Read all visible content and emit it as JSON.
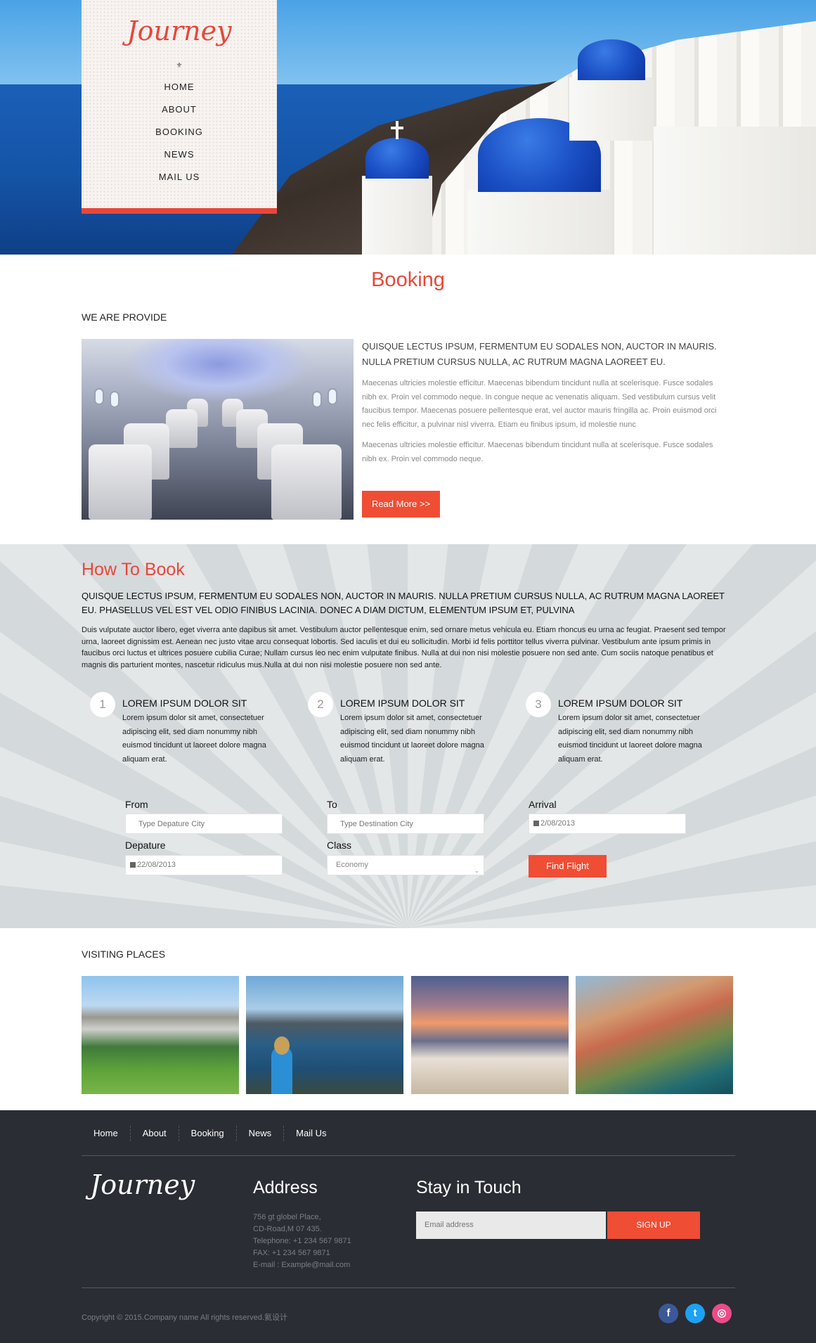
{
  "brand": {
    "logo": "Journey",
    "ornament": "⚜"
  },
  "nav": [
    "HOME",
    "ABOUT",
    "BOOKING",
    "NEWS",
    "MAIL US"
  ],
  "booking": {
    "title": "Booking",
    "provide_label": "WE ARE PROVIDE",
    "lead": "QUISQUE LECTUS IPSUM, FERMENTUM EU SODALES NON, AUCTOR IN MAURIS. NULLA PRETIUM CURSUS NULLA, AC RUTRUM MAGNA LAOREET EU.",
    "p1": "Maecenas ultricies molestie efficitur. Maecenas bibendum tincidunt nulla at scelerisque. Fusce sodales nibh ex. Proin vel commodo neque. In congue neque ac venenatis aliquam. Sed vestibulum cursus velit faucibus tempor. Maecenas posuere pellentesque erat, vel auctor mauris fringilla ac. Proin euismod orci nec felis efficitur, a pulvinar nisl viverra. Etiam eu finibus ipsum, id molestie nunc",
    "p2": "Maecenas ultricies molestie efficitur. Maecenas bibendum tincidunt nulla at scelerisque. Fusce sodales nibh ex. Proin vel commodo neque.",
    "read_more": "Read More >>"
  },
  "how": {
    "title": "How To Book",
    "lead": "QUISQUE LECTUS IPSUM, FERMENTUM EU SODALES NON, AUCTOR IN MAURIS. NULLA PRETIUM CURSUS NULLA, AC RUTRUM MAGNA LAOREET EU. PHASELLUS VEL EST VEL ODIO FINIBUS LACINIA. DONEC A DIAM DICTUM, ELEMENTUM IPSUM ET, PULVINA",
    "p": "Duis vulputate auctor libero, eget viverra ante dapibus sit amet. Vestibulum auctor pellentesque enim, sed ornare metus vehicula eu. Etiam rhoncus eu urna ac feugiat. Praesent sed tempor urna, laoreet dignissim est. Aenean nec justo vitae arcu consequat lobortis. Sed iaculis et dui eu sollicitudin. Morbi id felis porttitor tellus viverra pulvinar. Vestibulum ante ipsum primis in faucibus orci luctus et ultrices posuere cubilia Curae; Nullam cursus leo nec enim vulputate finibus. Nulla at dui non nisi molestie posuere non sed ante. Cum sociis natoque penatibus et magnis dis parturient montes, nascetur ridiculus mus.Nulla at dui non nisi molestie posuere non sed ante.",
    "steps": [
      {
        "num": "1",
        "title": "LOREM IPSUM DOLOR SIT",
        "text": "Lorem ipsum dolor sit amet, consectetuer adipiscing elit, sed diam nonummy nibh euismod tincidunt ut laoreet dolore magna aliquam erat."
      },
      {
        "num": "2",
        "title": "LOREM IPSUM DOLOR SIT",
        "text": "Lorem ipsum dolor sit amet, consectetuer adipiscing elit, sed diam nonummy nibh euismod tincidunt ut laoreet dolore magna aliquam erat."
      },
      {
        "num": "3",
        "title": "LOREM IPSUM DOLOR SIT",
        "text": "Lorem ipsum dolor sit amet, consectetuer adipiscing elit, sed diam nonummy nibh euismod tincidunt ut laoreet dolore magna aliquam erat."
      }
    ]
  },
  "form": {
    "from_label": "From",
    "from_placeholder": "Type Depature City",
    "to_label": "To",
    "to_placeholder": "Type Destination City",
    "arrival_label": "Arrival",
    "arrival_value": "2/08/2013",
    "depature_label": "Depature",
    "depature_value": "22/08/2013",
    "class_label": "Class",
    "class_value": "Economy",
    "find": "Find Flight"
  },
  "visiting": {
    "label": "VISITING PLACES"
  },
  "footer": {
    "nav": [
      "Home",
      "About",
      "Booking",
      "News",
      "Mail Us"
    ],
    "logo": "Journey",
    "address_title": "Address",
    "address_lines": [
      "756 gt globel Place,",
      "CD-Road,M 07 435.",
      "Telephone: +1 234 567 9871",
      "FAX: +1 234 567 9871",
      "E-mail : Example@mail.com"
    ],
    "touch_title": "Stay in Touch",
    "email_placeholder": "Email address",
    "signup": "SIGN UP",
    "copyright": "Copyright © 2015.Company name All rights reserved.氦设计",
    "social": [
      {
        "name": "facebook",
        "glyph": "f",
        "color": "#3b5998"
      },
      {
        "name": "twitter",
        "glyph": "t",
        "color": "#1da1f2"
      },
      {
        "name": "dribbble",
        "glyph": "◎",
        "color": "#ea4c89"
      }
    ]
  },
  "colors": {
    "accent": "#e8473a",
    "button": "#f04d35",
    "footer_bg": "#2a2d33",
    "section_bg": "#d9dee0"
  }
}
